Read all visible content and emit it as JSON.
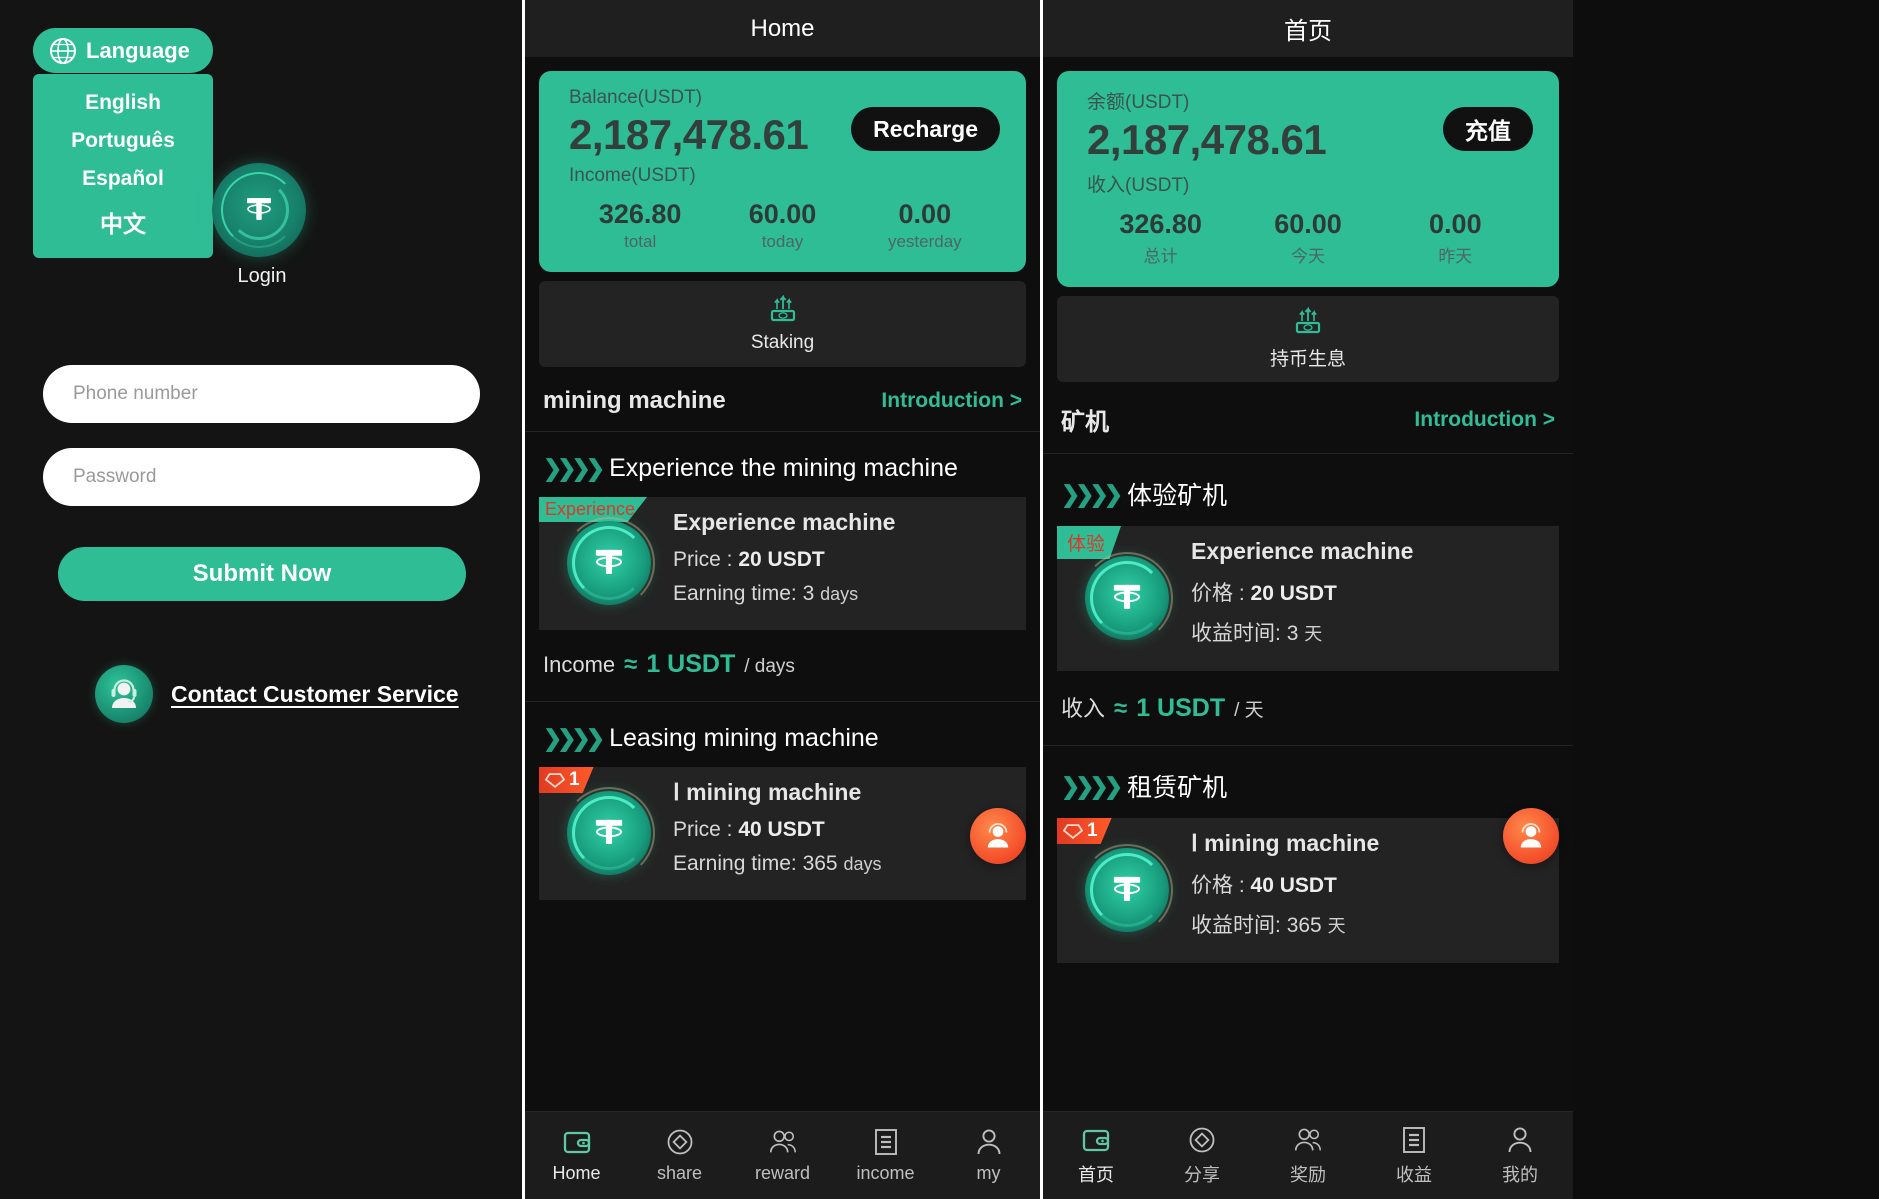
{
  "login": {
    "language_button": {
      "label": "Language",
      "icon": "globe-icon"
    },
    "language_options": [
      "English",
      "Português",
      "Español",
      "中文"
    ],
    "login_caption": "Login",
    "phone_placeholder": "Phone number",
    "phone_value": "",
    "password_placeholder": "Password",
    "password_value": "",
    "submit_label": "Submit Now",
    "customer_service_label": "Contact Customer Service",
    "accent_color": "#2fbd96",
    "background_color": "#141414"
  },
  "screens": [
    {
      "id": "home-en",
      "topbar_title": "Home",
      "balance": {
        "label": "Balance(USDT)",
        "value": "2,187,478.61",
        "recharge_label": "Recharge",
        "income_label": "Income(USDT)",
        "stats": [
          {
            "value": "326.80",
            "caption": "total"
          },
          {
            "value": "60.00",
            "caption": "today"
          },
          {
            "value": "0.00",
            "caption": "yesterday"
          }
        ]
      },
      "staking": {
        "label": "Staking",
        "icon": "staking-icon"
      },
      "section": {
        "title": "mining machine",
        "link": "Introduction >"
      },
      "experience": {
        "heading": "Experience the mining machine",
        "tag": "Experience",
        "name": "Experience machine",
        "price_label": "Price :",
        "price_value": "20 USDT",
        "time_label": "Earning time:",
        "time_value": "3",
        "time_unit": "days",
        "income_prefix": "Income",
        "income_approx": "≈",
        "income_amount": "1 USDT",
        "income_unit": "/ days"
      },
      "leasing": {
        "heading": "Leasing mining machine",
        "badge": "1",
        "name": "Ⅰ  mining machine",
        "price_label": "Price :",
        "price_value": "40 USDT",
        "time_label": "Earning time:",
        "time_value": "365",
        "time_unit": "days"
      },
      "nav": [
        {
          "label": "Home",
          "icon": "wallet-icon",
          "active": true
        },
        {
          "label": "share",
          "icon": "diamond-circle-icon",
          "active": false
        },
        {
          "label": "reward",
          "icon": "people-icon",
          "active": false
        },
        {
          "label": "income",
          "icon": "document-icon",
          "active": false
        },
        {
          "label": "my",
          "icon": "person-icon",
          "active": false
        }
      ]
    },
    {
      "id": "home-cn",
      "topbar_title": "首页",
      "balance": {
        "label": "余额(USDT)",
        "value": "2,187,478.61",
        "recharge_label": "充值",
        "income_label": "收入(USDT)",
        "stats": [
          {
            "value": "326.80",
            "caption": "总计"
          },
          {
            "value": "60.00",
            "caption": "今天"
          },
          {
            "value": "0.00",
            "caption": "昨天"
          }
        ]
      },
      "staking": {
        "label": "持币生息",
        "icon": "staking-icon"
      },
      "section": {
        "title": "矿机",
        "link": "Introduction >"
      },
      "experience": {
        "heading": "体验矿机",
        "tag": "体验",
        "name": "Experience machine",
        "price_label": "价格 :",
        "price_value": "20 USDT",
        "time_label": "收益时间:",
        "time_value": "3",
        "time_unit": "天",
        "income_prefix": "收入",
        "income_approx": "≈",
        "income_amount": "1 USDT",
        "income_unit": "/ 天"
      },
      "leasing": {
        "heading": "租赁矿机",
        "badge": "1",
        "name": "Ⅰ  mining machine",
        "price_label": "价格 :",
        "price_value": "40 USDT",
        "time_label": "收益时间:",
        "time_value": "365",
        "time_unit": "天"
      },
      "nav": [
        {
          "label": "首页",
          "icon": "wallet-icon",
          "active": true
        },
        {
          "label": "分享",
          "icon": "diamond-circle-icon",
          "active": false
        },
        {
          "label": "奖励",
          "icon": "people-icon",
          "active": false
        },
        {
          "label": "收益",
          "icon": "document-icon",
          "active": false
        },
        {
          "label": "我的",
          "icon": "person-icon",
          "active": false
        }
      ]
    }
  ]
}
